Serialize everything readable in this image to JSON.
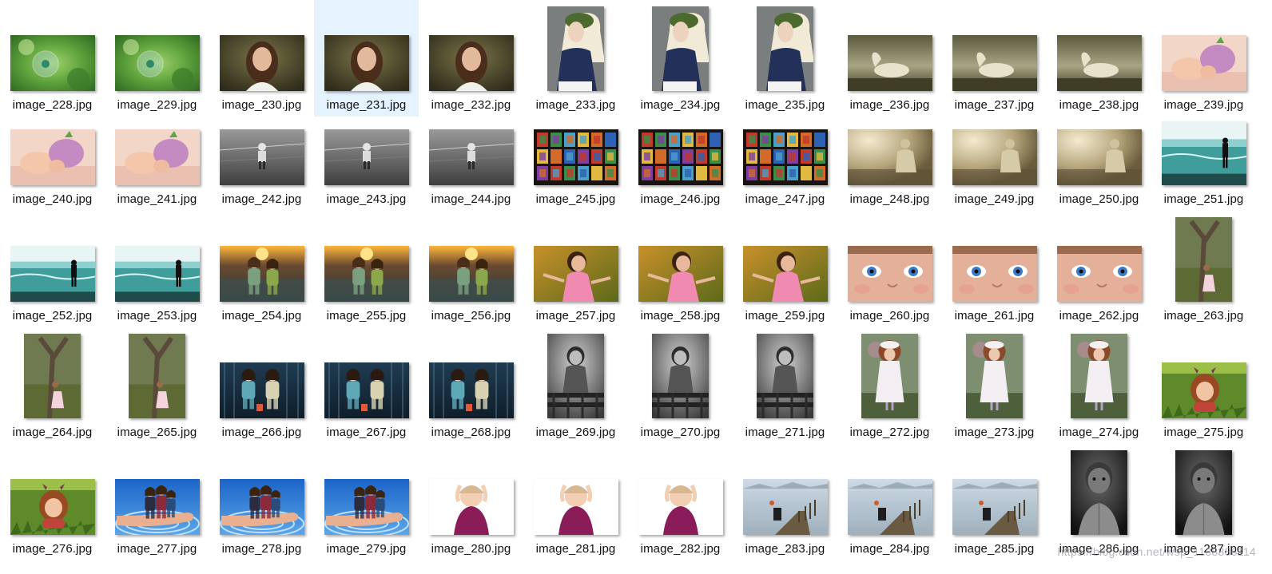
{
  "files": [
    {
      "name": "image_228.jpg",
      "kind": "bubble",
      "orient": "landscape"
    },
    {
      "name": "image_229.jpg",
      "kind": "bubble",
      "orient": "landscape"
    },
    {
      "name": "image_230.jpg",
      "kind": "girl-portrait",
      "orient": "landscape"
    },
    {
      "name": "image_231.jpg",
      "kind": "girl-portrait",
      "orient": "landscape",
      "selected": true
    },
    {
      "name": "image_232.jpg",
      "kind": "girl-portrait",
      "orient": "landscape"
    },
    {
      "name": "image_233.jpg",
      "kind": "girl-hat",
      "orient": "portrait"
    },
    {
      "name": "image_234.jpg",
      "kind": "girl-hat",
      "orient": "portrait"
    },
    {
      "name": "image_235.jpg",
      "kind": "girl-hat",
      "orient": "portrait"
    },
    {
      "name": "image_236.jpg",
      "kind": "horse",
      "orient": "landscape"
    },
    {
      "name": "image_237.jpg",
      "kind": "horse",
      "orient": "landscape"
    },
    {
      "name": "image_238.jpg",
      "kind": "horse",
      "orient": "landscape"
    },
    {
      "name": "image_239.jpg",
      "kind": "baby",
      "orient": "landscape"
    },
    {
      "name": "image_240.jpg",
      "kind": "baby",
      "orient": "landscape"
    },
    {
      "name": "image_241.jpg",
      "kind": "baby",
      "orient": "landscape"
    },
    {
      "name": "image_242.jpg",
      "kind": "bw-road",
      "orient": "landscape"
    },
    {
      "name": "image_243.jpg",
      "kind": "bw-road",
      "orient": "landscape"
    },
    {
      "name": "image_244.jpg",
      "kind": "bw-road",
      "orient": "landscape"
    },
    {
      "name": "image_245.jpg",
      "kind": "stained-glass",
      "orient": "landscape"
    },
    {
      "name": "image_246.jpg",
      "kind": "stained-glass",
      "orient": "landscape"
    },
    {
      "name": "image_247.jpg",
      "kind": "stained-glass",
      "orient": "landscape"
    },
    {
      "name": "image_248.jpg",
      "kind": "sepia-child",
      "orient": "landscape"
    },
    {
      "name": "image_249.jpg",
      "kind": "sepia-child",
      "orient": "landscape"
    },
    {
      "name": "image_250.jpg",
      "kind": "sepia-child",
      "orient": "landscape"
    },
    {
      "name": "image_251.jpg",
      "kind": "sea-child",
      "orient": "landscape-tall"
    },
    {
      "name": "image_252.jpg",
      "kind": "sea-child",
      "orient": "landscape"
    },
    {
      "name": "image_253.jpg",
      "kind": "sea-child",
      "orient": "landscape"
    },
    {
      "name": "image_254.jpg",
      "kind": "sunset-kids",
      "orient": "landscape"
    },
    {
      "name": "image_255.jpg",
      "kind": "sunset-kids",
      "orient": "landscape"
    },
    {
      "name": "image_256.jpg",
      "kind": "sunset-kids",
      "orient": "landscape"
    },
    {
      "name": "image_257.jpg",
      "kind": "pink-girl",
      "orient": "landscape"
    },
    {
      "name": "image_258.jpg",
      "kind": "pink-girl",
      "orient": "landscape"
    },
    {
      "name": "image_259.jpg",
      "kind": "pink-girl",
      "orient": "landscape"
    },
    {
      "name": "image_260.jpg",
      "kind": "blue-eyes",
      "orient": "landscape"
    },
    {
      "name": "image_261.jpg",
      "kind": "blue-eyes",
      "orient": "landscape"
    },
    {
      "name": "image_262.jpg",
      "kind": "blue-eyes",
      "orient": "landscape"
    },
    {
      "name": "image_263.jpg",
      "kind": "tree-girl",
      "orient": "portrait"
    },
    {
      "name": "image_264.jpg",
      "kind": "tree-girl",
      "orient": "portrait"
    },
    {
      "name": "image_265.jpg",
      "kind": "tree-girl",
      "orient": "portrait"
    },
    {
      "name": "image_266.jpg",
      "kind": "lantern-kids",
      "orient": "landscape"
    },
    {
      "name": "image_267.jpg",
      "kind": "lantern-kids",
      "orient": "landscape"
    },
    {
      "name": "image_268.jpg",
      "kind": "lantern-kids",
      "orient": "landscape"
    },
    {
      "name": "image_269.jpg",
      "kind": "bw-fence",
      "orient": "portrait"
    },
    {
      "name": "image_270.jpg",
      "kind": "bw-fence",
      "orient": "portrait"
    },
    {
      "name": "image_271.jpg",
      "kind": "bw-fence",
      "orient": "portrait"
    },
    {
      "name": "image_272.jpg",
      "kind": "white-dress",
      "orient": "portrait"
    },
    {
      "name": "image_273.jpg",
      "kind": "white-dress",
      "orient": "portrait"
    },
    {
      "name": "image_274.jpg",
      "kind": "white-dress",
      "orient": "portrait"
    },
    {
      "name": "image_275.jpg",
      "kind": "grass-girl",
      "orient": "landscape"
    },
    {
      "name": "image_276.jpg",
      "kind": "grass-girl",
      "orient": "landscape"
    },
    {
      "name": "image_277.jpg",
      "kind": "hand-family",
      "orient": "landscape"
    },
    {
      "name": "image_278.jpg",
      "kind": "hand-family",
      "orient": "landscape"
    },
    {
      "name": "image_279.jpg",
      "kind": "hand-family",
      "orient": "landscape"
    },
    {
      "name": "image_280.jpg",
      "kind": "white-bg-kid",
      "orient": "landscape"
    },
    {
      "name": "image_281.jpg",
      "kind": "white-bg-kid",
      "orient": "landscape"
    },
    {
      "name": "image_282.jpg",
      "kind": "white-bg-kid",
      "orient": "landscape"
    },
    {
      "name": "image_283.jpg",
      "kind": "pier",
      "orient": "landscape"
    },
    {
      "name": "image_284.jpg",
      "kind": "pier",
      "orient": "landscape"
    },
    {
      "name": "image_285.jpg",
      "kind": "pier",
      "orient": "landscape"
    },
    {
      "name": "image_286.jpg",
      "kind": "bw-boy",
      "orient": "portrait"
    },
    {
      "name": "image_287.jpg",
      "kind": "bw-boy",
      "orient": "portrait"
    }
  ],
  "watermark": "https://blog.csdn.net/wsp_1138886114"
}
